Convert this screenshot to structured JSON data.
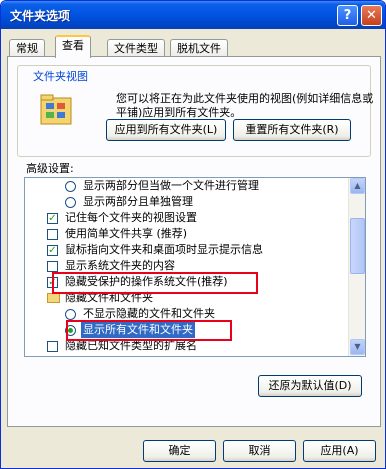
{
  "window": {
    "title": "文件夹选项",
    "help_glyph": "?",
    "close_glyph": "✕"
  },
  "tabs": [
    {
      "label": "常规"
    },
    {
      "label": "查看"
    },
    {
      "label": "文件类型"
    },
    {
      "label": "脱机文件"
    }
  ],
  "folder_views": {
    "title": "文件夹视图",
    "description": "您可以将正在为此文件夹使用的视图(例如详细信息或平铺)应用到所有文件夹。",
    "apply_all_label": "应用到所有文件夹(L)",
    "reset_all_label": "重置所有文件夹(R)"
  },
  "advanced": {
    "label": "高级设置:",
    "items": [
      {
        "kind": "radio",
        "checked": false,
        "indent": 1,
        "text": "显示两部分但当做一个文件进行管理"
      },
      {
        "kind": "radio",
        "checked": false,
        "indent": 1,
        "text": "显示两部分且单独管理"
      },
      {
        "kind": "checkbox",
        "checked": true,
        "indent": 0,
        "text": "记住每个文件夹的视图设置"
      },
      {
        "kind": "checkbox",
        "checked": false,
        "indent": 0,
        "text": "使用简单文件共享 (推荐)"
      },
      {
        "kind": "checkbox",
        "checked": true,
        "indent": 0,
        "text": "鼠标指向文件夹和桌面项时显示提示信息"
      },
      {
        "kind": "checkbox",
        "checked": false,
        "indent": 0,
        "text": "显示系统文件夹的内容"
      },
      {
        "kind": "checkbox",
        "checked": true,
        "indent": 0,
        "text": "隐藏受保护的操作系统文件(推荐)"
      },
      {
        "kind": "folder",
        "checked": false,
        "indent": 0,
        "text": "隐藏文件和文件夹"
      },
      {
        "kind": "radio",
        "checked": false,
        "indent": 1,
        "text": "不显示隐藏的文件和文件夹"
      },
      {
        "kind": "radio",
        "checked": true,
        "indent": 1,
        "text": "显示所有文件和文件夹",
        "selected": true
      },
      {
        "kind": "checkbox",
        "checked": false,
        "indent": 0,
        "text": "隐藏已知文件类型的扩展名"
      }
    ],
    "restore_label": "还原为默认值(D)"
  },
  "footer": {
    "ok_label": "确定",
    "cancel_label": "取消",
    "apply_label": "应用(A)"
  },
  "colors": {
    "titlebar": "#0053e1",
    "selection": "#316ac5",
    "highlight_box": "#e8001c",
    "check": "#21a121"
  },
  "icons": [
    "help-icon",
    "close-icon",
    "folder-view-icon",
    "checkbox-icon",
    "radio-icon",
    "folder-icon",
    "scroll-up-icon",
    "scroll-down-icon"
  ]
}
